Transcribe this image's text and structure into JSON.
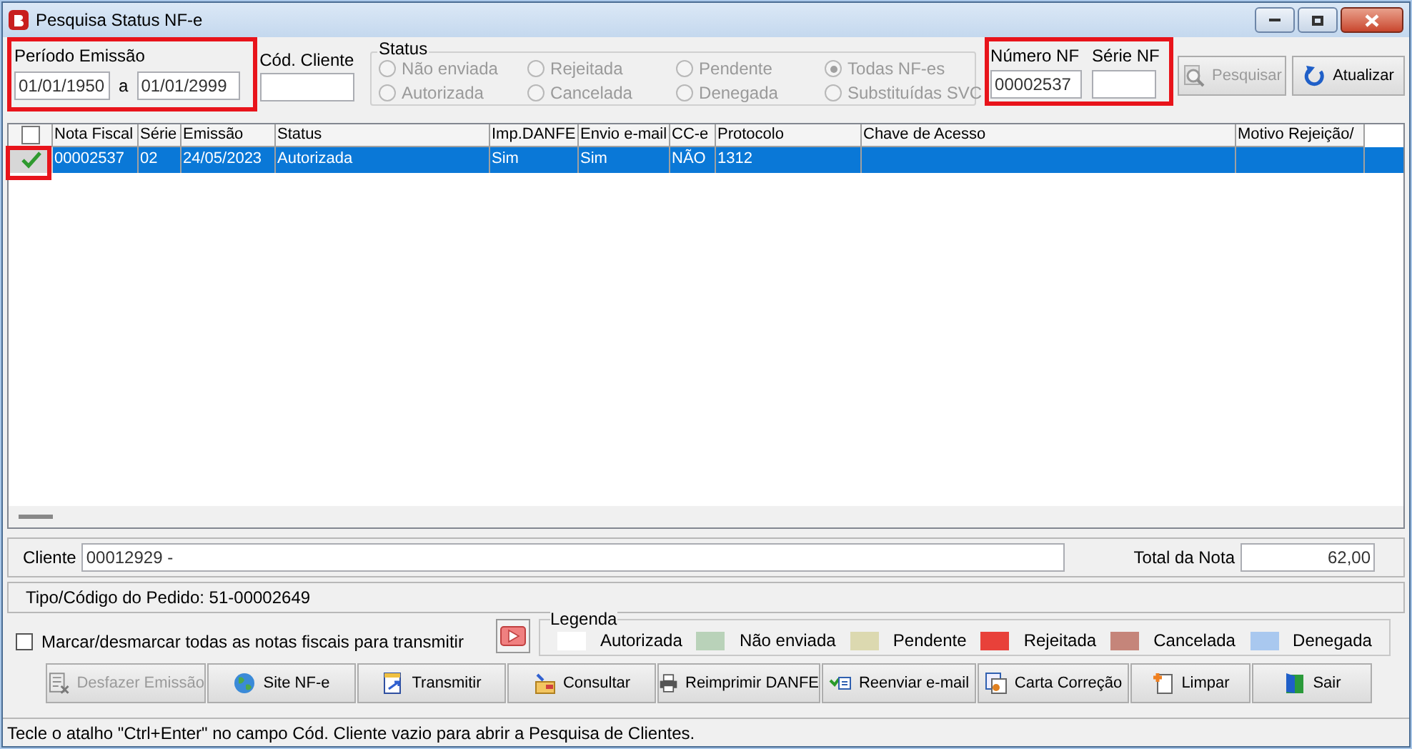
{
  "window": {
    "title": "Pesquisa Status NF-e"
  },
  "periodo": {
    "label": "Período Emissão",
    "from": "01/01/1950",
    "separator": "a",
    "to": "01/01/2999",
    "highlighted": true
  },
  "cod_cliente": {
    "label": "Cód. Cliente"
  },
  "status": {
    "label": "Status",
    "options": [
      {
        "label": "Não enviada",
        "selected": false
      },
      {
        "label": "Autorizada",
        "selected": false
      },
      {
        "label": "Rejeitada",
        "selected": false
      },
      {
        "label": "Cancelada",
        "selected": false
      },
      {
        "label": "Pendente",
        "selected": false
      },
      {
        "label": "Denegada",
        "selected": false
      },
      {
        "label": "Todas NF-es",
        "selected": true
      },
      {
        "label": "Substituídas SVC",
        "selected": false
      }
    ]
  },
  "numero_nf": {
    "label": "Número NF",
    "value": "00002537",
    "highlighted": true
  },
  "serie_nf": {
    "label": "Série NF"
  },
  "search_buttons": [
    {
      "label": "Pesquisar",
      "kind": "search",
      "disabled": true
    },
    {
      "label": "Atualizar",
      "kind": "refresh",
      "disabled": false
    }
  ],
  "table": {
    "columns": [
      "Nota Fiscal",
      "Série",
      "Emissão",
      "Status",
      "Imp.DANFE",
      "Envio e-mail",
      "CC-e",
      "Protocolo",
      "Chave de Acesso",
      "Motivo Rejeição/"
    ],
    "all_checked": false,
    "rows": [
      {
        "checked": true,
        "highlighted": true,
        "selected": true,
        "cells": [
          "00002537",
          "02",
          "24/05/2023",
          "Autorizada",
          "Sim",
          "Sim",
          "NÃO",
          "1312"
        ]
      }
    ]
  },
  "cliente": {
    "label": "Cliente",
    "value": "00012929 -"
  },
  "total": {
    "label": "Total da Nota",
    "value": "62,00"
  },
  "pedido": {
    "text": "Tipo/Código do Pedido: 51-00002649"
  },
  "marcar": {
    "label": "Marcar/desmarcar todas as notas fiscais para transmitir",
    "checked": false
  },
  "legenda": {
    "label": "Legenda",
    "items": [
      {
        "label": "Autorizada",
        "color": "#ffffff"
      },
      {
        "label": "Não enviada",
        "color": "#b9d2b9"
      },
      {
        "label": "Pendente",
        "color": "#dcd9b0"
      },
      {
        "label": "Rejeitada",
        "color": "#e8413a"
      },
      {
        "label": "Cancelada",
        "color": "#c5857a"
      },
      {
        "label": "Denegada",
        "color": "#a9c8ef"
      }
    ]
  },
  "buttons": [
    {
      "label": "Desfazer Emissão",
      "kind": "undo",
      "disabled": true
    },
    {
      "label": "Site NF-e",
      "kind": "globe",
      "disabled": false
    },
    {
      "label": "Transmitir",
      "kind": "send",
      "disabled": false
    },
    {
      "label": "Consultar",
      "kind": "query",
      "disabled": false
    },
    {
      "label": "Reimprimir DANFE",
      "kind": "printer",
      "disabled": false
    },
    {
      "label": "Reenviar e-mail",
      "kind": "mail",
      "disabled": false
    },
    {
      "label": "Carta Correção",
      "kind": "letter",
      "disabled": false
    },
    {
      "label": "Limpar",
      "kind": "new",
      "disabled": false
    },
    {
      "label": "Sair",
      "kind": "exit",
      "disabled": false
    }
  ],
  "status_bar": "Tecle o atalho \"Ctrl+Enter\" no campo Cód. Cliente vazio para abrir a Pesquisa de Clientes."
}
